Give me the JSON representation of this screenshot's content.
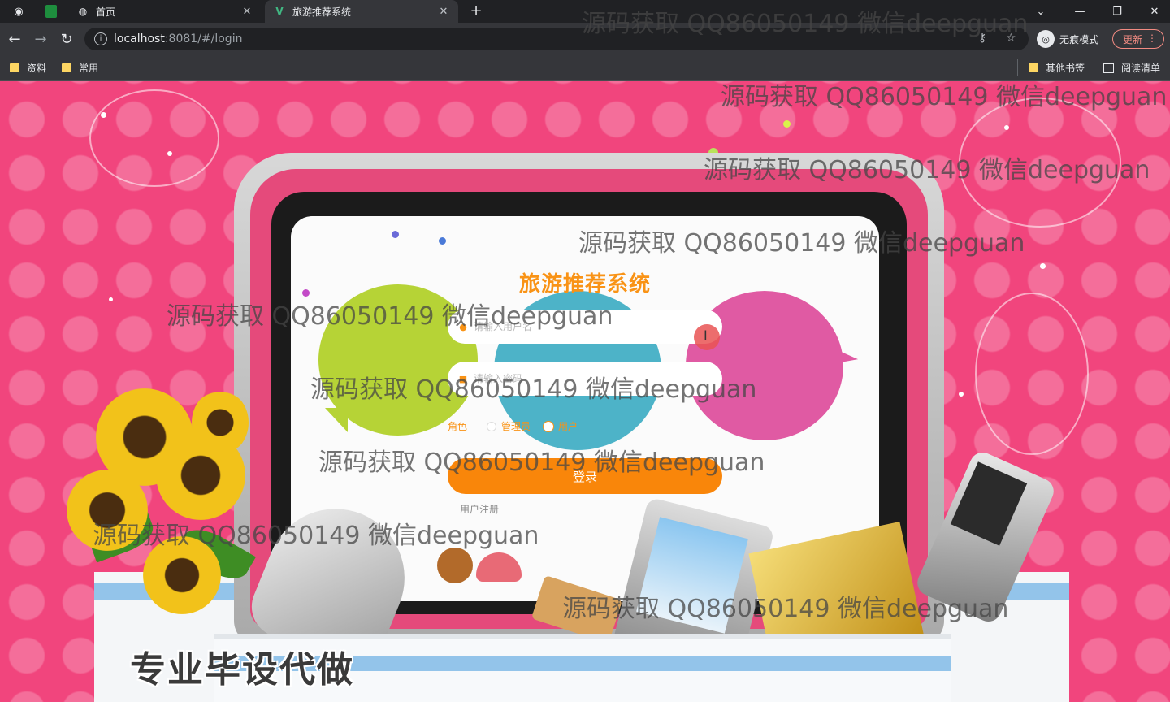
{
  "browser": {
    "tabs": [
      {
        "label": "首页",
        "active": false
      },
      {
        "label": "旅游推荐系统",
        "active": true
      }
    ],
    "tab_close_glyph": "✕",
    "new_tab_glyph": "+",
    "url_host": "localhost",
    "url_rest": ":8081/#/login",
    "profile_label": "无痕模式",
    "update_label": "更新",
    "bookmarks": [
      {
        "label": "资料"
      },
      {
        "label": "常用"
      }
    ],
    "bookmarks_right": [
      {
        "label": "其他书签"
      },
      {
        "label": "阅读清单"
      }
    ],
    "icons": [
      "globe-icon",
      "sheets-icon",
      "back-icon",
      "forward-icon",
      "reload-icon",
      "info-icon",
      "key-icon",
      "star-icon",
      "incognito-icon",
      "menu-icon",
      "folder-icon",
      "reading-list-icon"
    ]
  },
  "login": {
    "title": "旅游推荐系统",
    "username_placeholder": "请输入用户名",
    "password_placeholder": "请输入密码",
    "role_label": "角色",
    "roles": [
      {
        "label": "管理员",
        "checked": false
      },
      {
        "label": "用户",
        "checked": true
      }
    ],
    "submit_label": "登录",
    "register_label": "用户注册"
  },
  "decoration": {
    "promo_text": "专业毕设代做",
    "watermark": "源码获取 QQ86050149 微信deepguan"
  },
  "colors": {
    "page_pink": "#f1457d",
    "accent_orange": "#f9860a",
    "title_orange": "#f99316",
    "chrome_dark": "#202124",
    "chrome_toolbar": "#35363a"
  }
}
